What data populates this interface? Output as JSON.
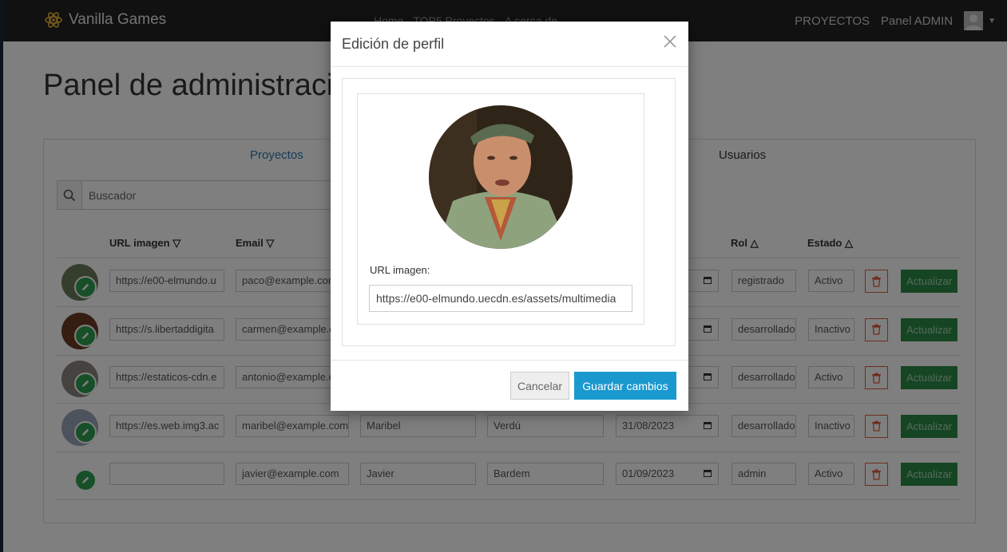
{
  "navbar": {
    "brand": "Vanilla Games",
    "links": [
      "Home",
      "TOP5 Proyectos",
      "A cerca de"
    ],
    "right_links": [
      "PROYECTOS",
      "Panel ADMIN"
    ]
  },
  "page": {
    "title": "Panel de administración",
    "tabs": [
      "Proyectos",
      "Usuarios"
    ],
    "search_placeholder": "Buscador"
  },
  "table": {
    "headers": [
      "URL imagen",
      "Email",
      "Rol",
      "Estado"
    ],
    "update_label": "Actualizar",
    "rows": [
      {
        "url": "https://e00-elmundo.u",
        "email": "paco@example.com",
        "nombre": "",
        "apellido": "",
        "fecha": "",
        "rol": "registrado",
        "estado": "Activo",
        "avatar_color": "#6b7a5a"
      },
      {
        "url": "https://s.libertaddigita",
        "email": "carmen@example.com",
        "nombre": "",
        "apellido": "",
        "fecha": "",
        "rol": "desarrollador",
        "estado": "Inactivo",
        "avatar_color": "#6a3a24"
      },
      {
        "url": "https://estaticos-cdn.e",
        "email": "antonio@example.com",
        "nombre": "",
        "apellido": "",
        "fecha": "",
        "rol": "desarrollador",
        "estado": "Activo",
        "avatar_color": "#8b8580"
      },
      {
        "url": "https://es.web.img3.ac",
        "email": "maribel@example.com",
        "nombre": "Maribel",
        "apellido": "Verdú",
        "fecha": "31/08/2023",
        "rol": "desarrollador",
        "estado": "Inactivo",
        "avatar_color": "#9aa6b8"
      },
      {
        "url": "",
        "email": "javier@example.com",
        "nombre": "Javier",
        "apellido": "Bardem",
        "fecha": "01/09/2023",
        "rol": "admin",
        "estado": "Activo",
        "avatar_color": ""
      }
    ]
  },
  "modal": {
    "title": "Edición de perfil",
    "url_label": "URL imagen:",
    "url_value": "https://e00-elmundo.uecdn.es/assets/multimedia",
    "cancel_label": "Cancelar",
    "save_label": "Guardar cambios"
  },
  "colors": {
    "navbar": "#222222",
    "primary": "#1a99cf",
    "success": "#2c8a47",
    "danger": "#e05a3f",
    "link": "#2a7ab0"
  }
}
